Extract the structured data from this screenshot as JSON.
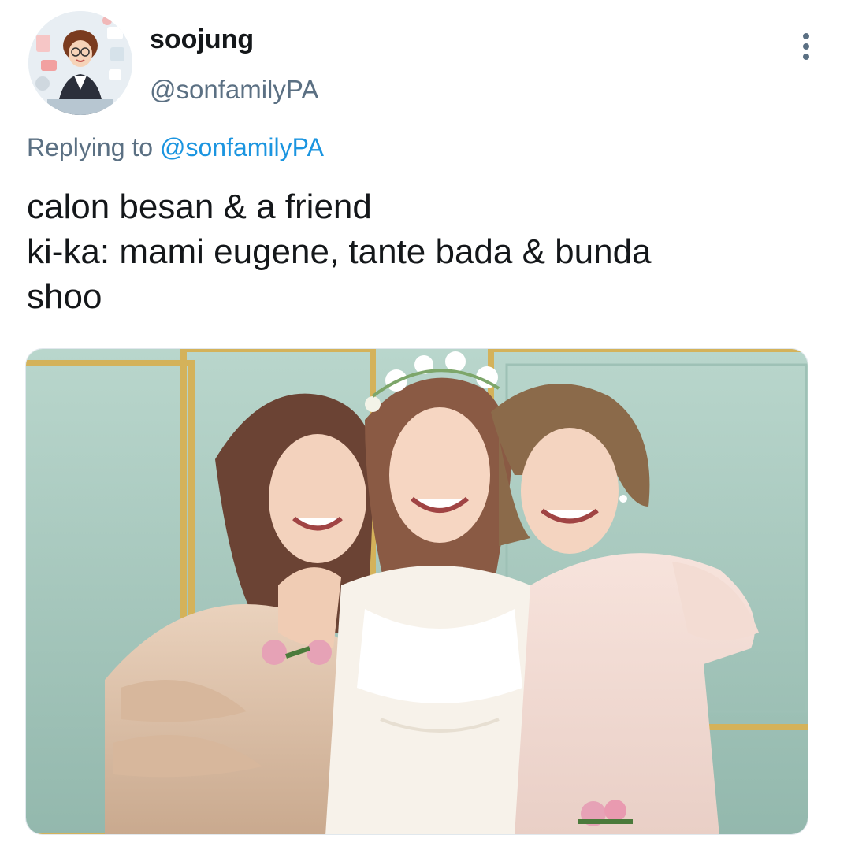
{
  "tweet": {
    "author": {
      "display_name": "soojung",
      "handle": "@sonfamilyPA"
    },
    "reply": {
      "prefix": "Replying to",
      "mention": "@sonfamilyPA"
    },
    "text_lines": [
      "calon besan & a friend",
      "ki-ka: mami eugene, tante bada & bunda",
      "shoo"
    ],
    "media": {
      "type": "photo",
      "description_icon": "photo-three-women-icon"
    },
    "menu_icon": "more-vertical-icon"
  },
  "colors": {
    "text_primary": "#14171a",
    "text_secondary": "#5b7083",
    "link": "#1b95e0",
    "photo_wall": "#a9c9bf",
    "photo_frame": "#c9a44c"
  }
}
